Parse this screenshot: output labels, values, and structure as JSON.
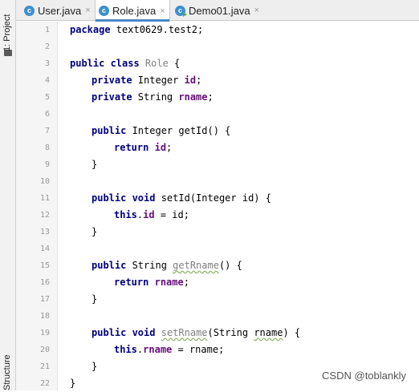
{
  "sidebar": {
    "project_label": "1: Project",
    "structure_label": "Structure"
  },
  "tabs": [
    {
      "label": "User.java",
      "close": "×",
      "icon": "class-c-icon"
    },
    {
      "label": "Role.java",
      "close": "×",
      "icon": "class-c-icon",
      "active": true
    },
    {
      "label": "Demo01.java",
      "close": "×",
      "icon": "runnable-class-icon"
    }
  ],
  "line_numbers": [
    "1",
    "2",
    "3",
    "4",
    "5",
    "6",
    "7",
    "8",
    "9",
    "10",
    "11",
    "12",
    "13",
    "14",
    "15",
    "16",
    "17",
    "18",
    "19",
    "20",
    "21",
    "22"
  ],
  "code": {
    "l1_kw": "package",
    "l1_rest": " text0629.test2;",
    "l3_kw": "public class",
    "l3_name": " Role",
    "l3_rest": " {",
    "l4_kw": "private",
    "l4_type": " Integer ",
    "l4_field": "id",
    "l4_end": ";",
    "l5_kw": "private",
    "l5_type": " String ",
    "l5_field": "rname",
    "l5_end": ";",
    "l7_kw": "public",
    "l7_rest": " Integer getId() {",
    "l8_kw": "return",
    "l8_sp": " ",
    "l8_field": "id",
    "l8_end": ";",
    "l9": "}",
    "l11_kw": "public void",
    "l11_rest": " setId(Integer id) {",
    "l12_kw": "this",
    "l12_dot": ".",
    "l12_field": "id",
    "l12_rest": " = id;",
    "l13": "}",
    "l15_kw": "public",
    "l15_type": " String ",
    "l15_name": "getRname",
    "l15_rest": "() {",
    "l16_kw": "return",
    "l16_sp": " ",
    "l16_field": "rname",
    "l16_end": ";",
    "l17": "}",
    "l19_kw": "public void",
    "l19_sp": " ",
    "l19_name": "setRname",
    "l19_a": "(String ",
    "l19_param": "rname",
    "l19_b": ") {",
    "l20_kw": "this",
    "l20_dot": ".",
    "l20_field": "rname",
    "l20_rest": " = rname;",
    "l21": "}",
    "l22": "}"
  },
  "watermark": "CSDN @toblankly",
  "colors": {
    "keyword": "#000080",
    "field": "#660e7a",
    "unused": "#808080",
    "tab_accent": "#4a88c7"
  }
}
